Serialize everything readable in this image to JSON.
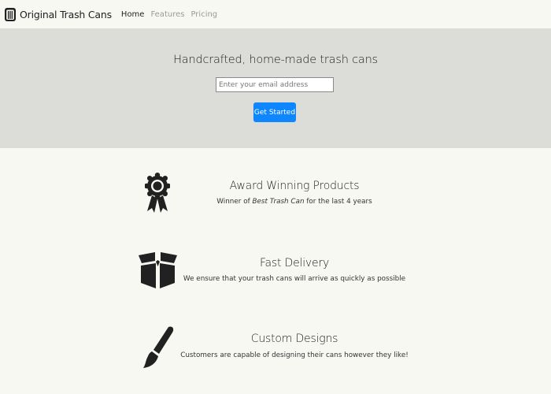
{
  "navbar": {
    "brand": "Original Trash Cans",
    "brand_icon": "trash-can-icon",
    "links": [
      {
        "label": "Home",
        "state": "active"
      },
      {
        "label": "Features",
        "state": "muted"
      },
      {
        "label": "Pricing",
        "state": "muted"
      }
    ]
  },
  "hero": {
    "title": "Handcrafted, home-made trash cans",
    "email_placeholder": "Enter your email address",
    "email_value": "",
    "cta_label": "Get Started",
    "cta_color": "#0d86ff",
    "background": "#dcdcd8"
  },
  "features": [
    {
      "icon": "award-ribbon-icon",
      "title": "Award Winning Products",
      "desc_prefix": "Winner of ",
      "desc_emphasis": "Best Trash Can",
      "desc_suffix": " for the last 4 years"
    },
    {
      "icon": "open-box-icon",
      "title": "Fast Delivery",
      "desc": "We ensure that your trash cans will arrive as quickly as possible"
    },
    {
      "icon": "paint-brush-icon",
      "title": "Custom Designs",
      "desc": "Customers are capable of designing their cans however they like!"
    }
  ]
}
